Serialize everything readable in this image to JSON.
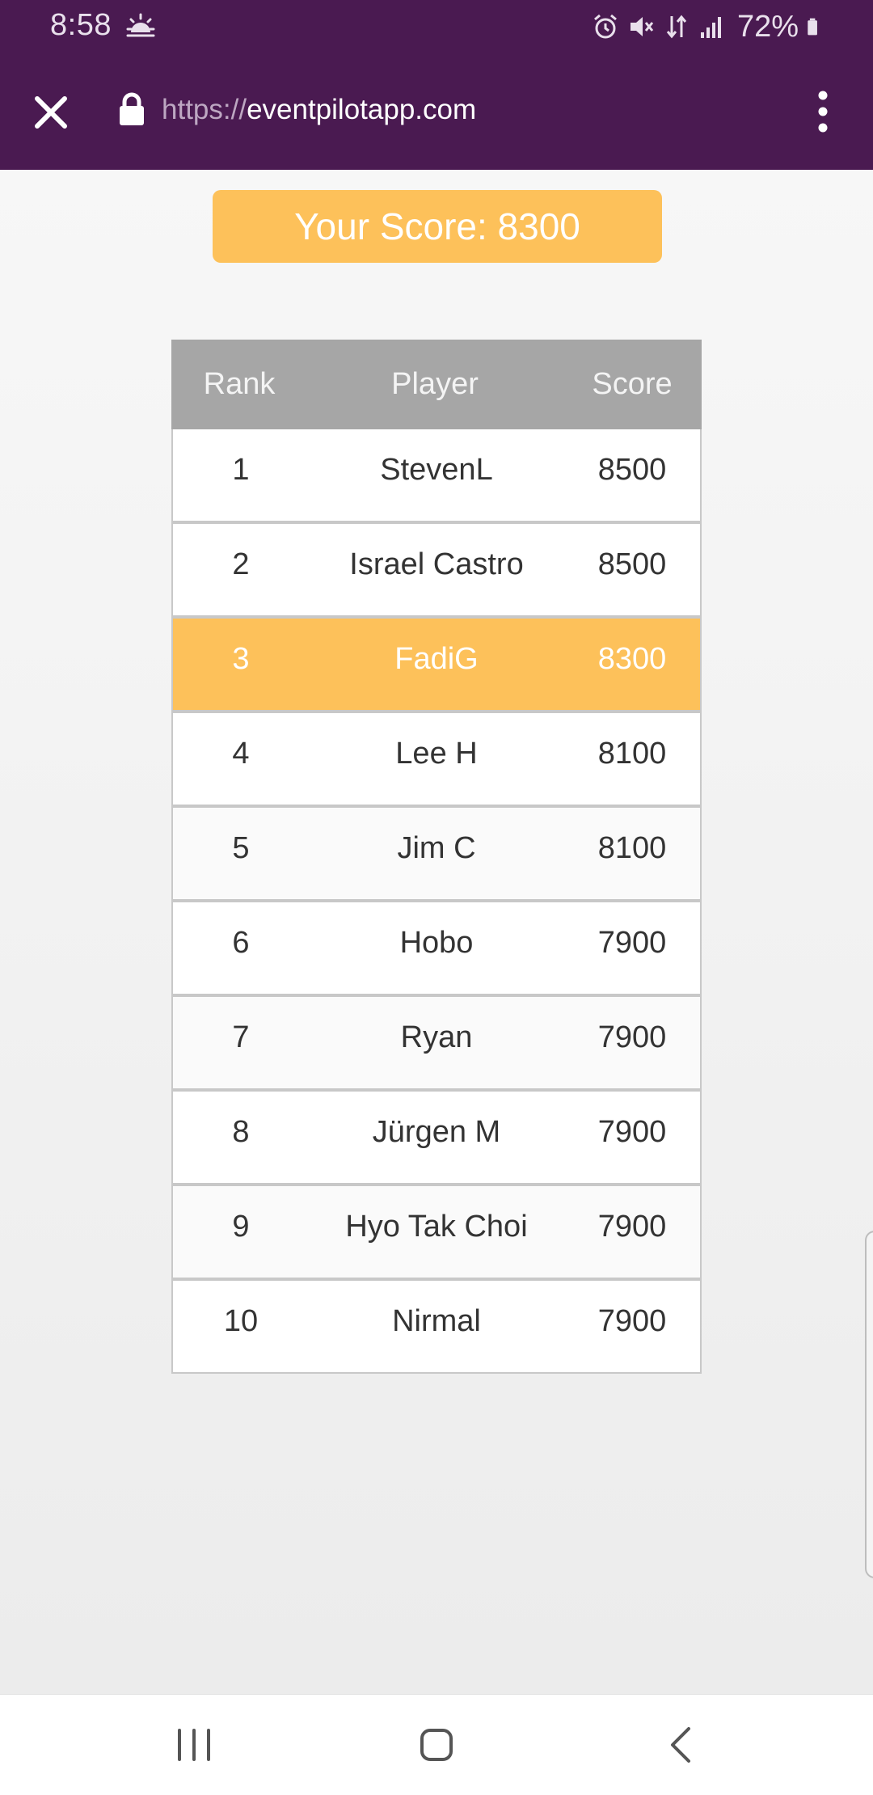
{
  "status_bar": {
    "time": "8:58",
    "battery": "72%",
    "icons": [
      "weather-icon",
      "alarm-icon",
      "mute-icon",
      "data-icon",
      "signal-icon",
      "battery-icon"
    ]
  },
  "browser": {
    "url_scheme": "https://",
    "url_host": "eventpilotapp.com"
  },
  "score": {
    "label": "Your Score: 8300"
  },
  "leaderboard": {
    "headers": {
      "rank": "Rank",
      "player": "Player",
      "score": "Score"
    },
    "rows": [
      {
        "rank": "1",
        "player": "StevenL",
        "score": "8500"
      },
      {
        "rank": "2",
        "player": "Israel Castro",
        "score": "8500"
      },
      {
        "rank": "3",
        "player": "FadiG",
        "score": "8300"
      },
      {
        "rank": "4",
        "player": "Lee H",
        "score": "8100"
      },
      {
        "rank": "5",
        "player": "Jim C",
        "score": "8100"
      },
      {
        "rank": "6",
        "player": "Hobo",
        "score": "7900"
      },
      {
        "rank": "7",
        "player": "Ryan",
        "score": "7900"
      },
      {
        "rank": "8",
        "player": "Jürgen M",
        "score": "7900"
      },
      {
        "rank": "9",
        "player": "Hyo Tak Choi",
        "score": "7900"
      },
      {
        "rank": "10",
        "player": "Nirmal",
        "score": "7900"
      }
    ],
    "highlight_color": "#fdc15a"
  },
  "colors": {
    "toolbar": "#4a1a51",
    "accent": "#fdc15a",
    "header": "#a6a6a6"
  }
}
